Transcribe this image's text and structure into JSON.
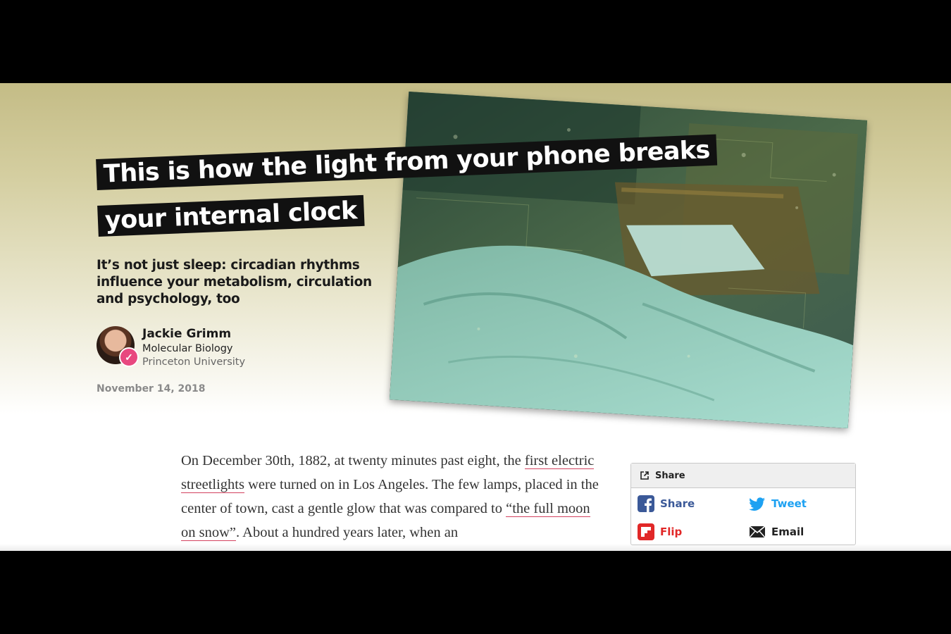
{
  "article": {
    "headline_line1": "This is how the light from your phone breaks",
    "headline_line2": "your internal clock",
    "subhead": "It’s not just sleep: circadian rhythms influence your metabolism, circulation and psychology, too",
    "author": {
      "name": "Jackie Grimm",
      "department": "Molecular Biology",
      "institution": "Princeton University"
    },
    "date": "November 14, 2018",
    "body": {
      "p1_part1": "On December 30th, 1882, at twenty minutes past eight, the ",
      "link1": "first electric streetlights",
      "p1_part2": " were turned on in Los Angeles. The few lamps, placed in the center of town, cast a gentle glow that was compared to ",
      "link2": "“the full moon on snow”",
      "p1_part3": ". About a hundred years later, when an"
    }
  },
  "share": {
    "header": "Share",
    "facebook": "Share",
    "twitter": "Tweet",
    "flipboard": "Flip",
    "email": "Email"
  },
  "colors": {
    "headline_bg": "#111111",
    "facebook": "#3b5998",
    "twitter": "#1da1f2",
    "flipboard": "#e12828",
    "link_underline": "#d3425f",
    "verified_badge": "#e8487f"
  }
}
